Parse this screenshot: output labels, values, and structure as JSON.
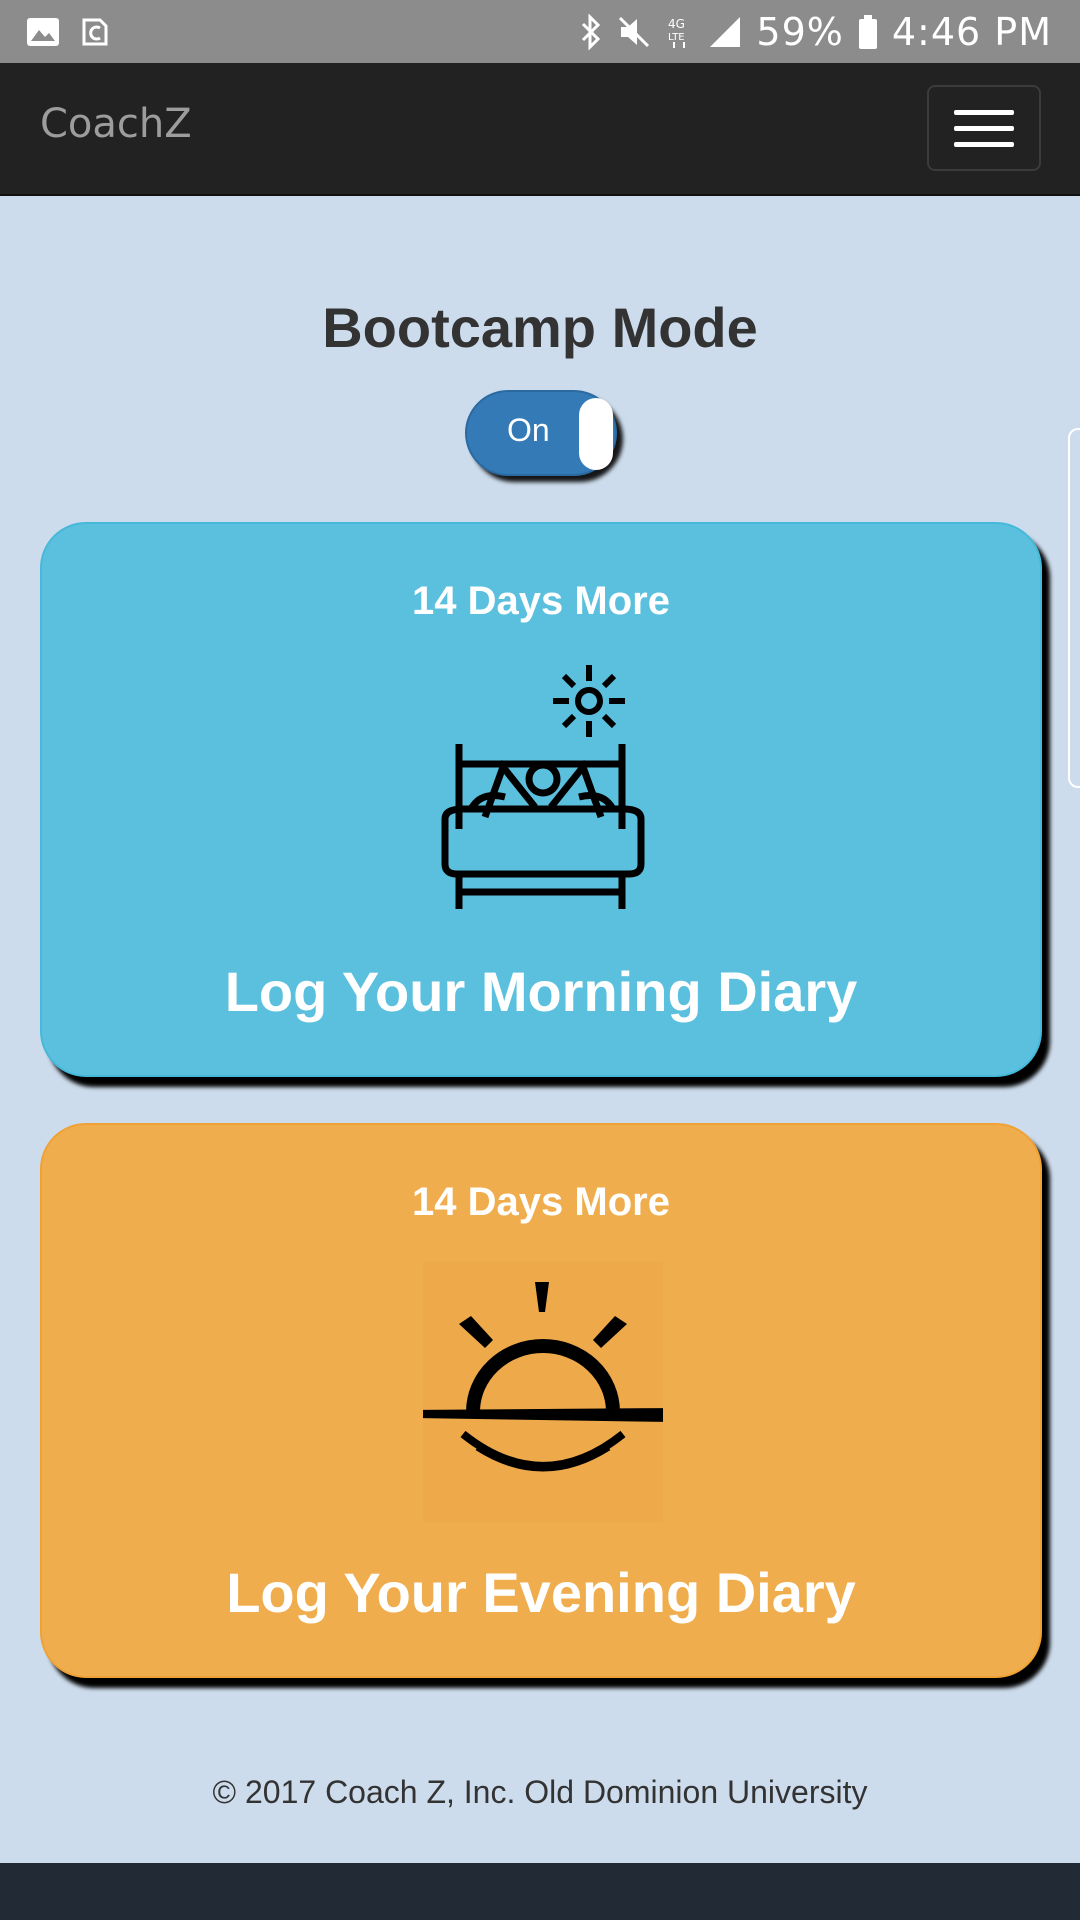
{
  "status_bar": {
    "battery": "59%",
    "time": "4:46 PM",
    "left_icons": [
      "gallery-icon",
      "app-notification-icon"
    ],
    "right_icons": [
      "bluetooth-icon",
      "mute-icon",
      "lte-icon",
      "signal-icon",
      "battery-icon"
    ]
  },
  "navbar": {
    "brand": "CoachZ",
    "menu_icon": "hamburger-icon"
  },
  "mode": {
    "title": "Bootcamp Mode",
    "toggle_label": "On"
  },
  "cards": [
    {
      "days": "14 Days More",
      "label": "Log Your Morning Diary",
      "icon": "wake-up-bed-icon",
      "color": "#5bc0de"
    },
    {
      "days": "14 Days More",
      "label": "Log Your Evening Diary",
      "icon": "sunset-icon",
      "color": "#f0ad4e"
    }
  ],
  "footer": {
    "copyright": "© 2017 Coach Z, Inc. Old Dominion University"
  },
  "colors": {
    "background": "#cddcec",
    "navbar": "#222222",
    "toggle": "#337ab7"
  }
}
